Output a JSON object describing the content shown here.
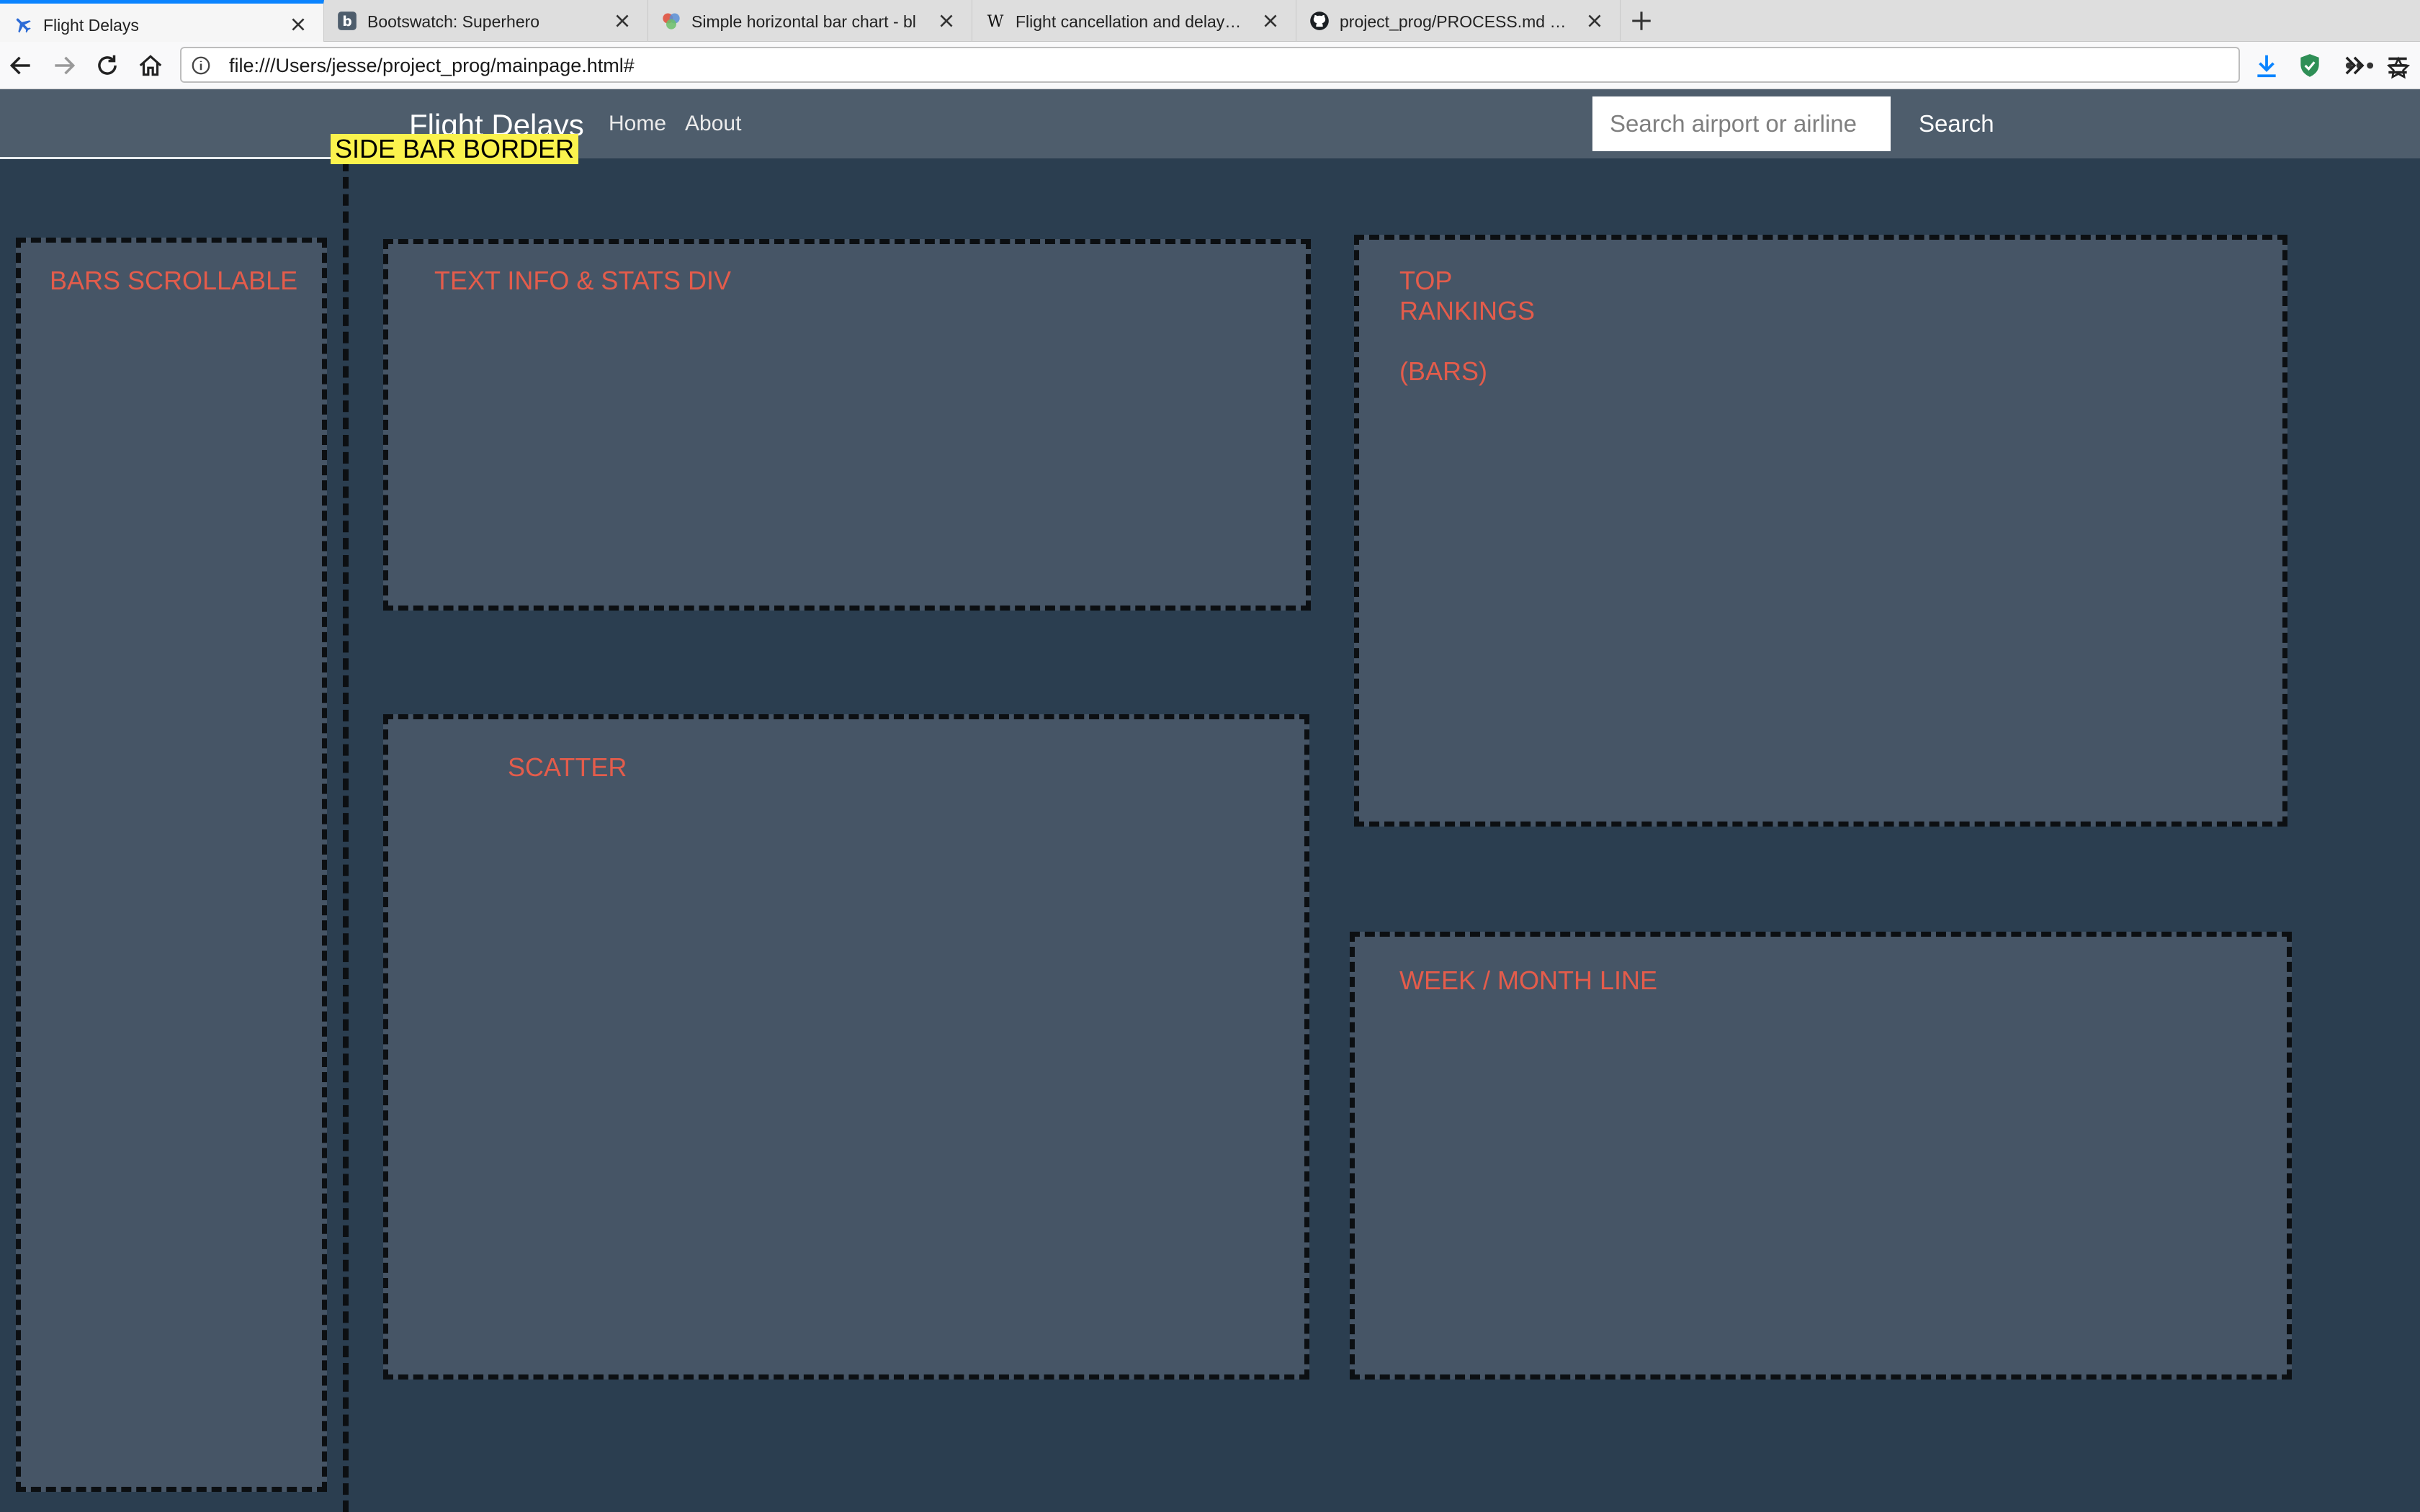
{
  "browser": {
    "tabs": [
      {
        "title": "Flight Delays",
        "icon": "airplane-icon",
        "active": true
      },
      {
        "title": "Bootswatch: Superhero",
        "icon": "bootswatch-icon",
        "active": false
      },
      {
        "title": "Simple horizontal bar chart - bl",
        "icon": "blocks-icon",
        "active": false
      },
      {
        "title": "Flight cancellation and delay - W",
        "icon": "wikipedia-icon",
        "active": false
      },
      {
        "title": "project_prog/PROCESS.md at m",
        "icon": "github-icon",
        "active": false
      }
    ],
    "url": "file:///Users/jesse/project_prog/mainpage.html#"
  },
  "navbar": {
    "brand": "Flight Delays",
    "links": [
      "Home",
      "About"
    ],
    "search_placeholder": "Search airport or airline",
    "search_button": "Search"
  },
  "annotations": {
    "sidebar_border": "SIDE BAR BORDER",
    "bars_scrollable": "BARS SCROLLABLE",
    "text_info": "TEXT INFO & STATS DIV",
    "top_rankings": "TOP\nRANKINGS\n\n(BARS)",
    "scatter": "SCATTER",
    "week_month_line": "WEEK / MONTH LINE"
  },
  "colors": {
    "page_bg": "#2b3e50",
    "panel_bg": "#465566",
    "navbar_bg": "#4e5d6c",
    "annotation_red": "#e45c4b",
    "label_yellow": "#fbf34d",
    "tab_accent": "#0a84ff"
  }
}
